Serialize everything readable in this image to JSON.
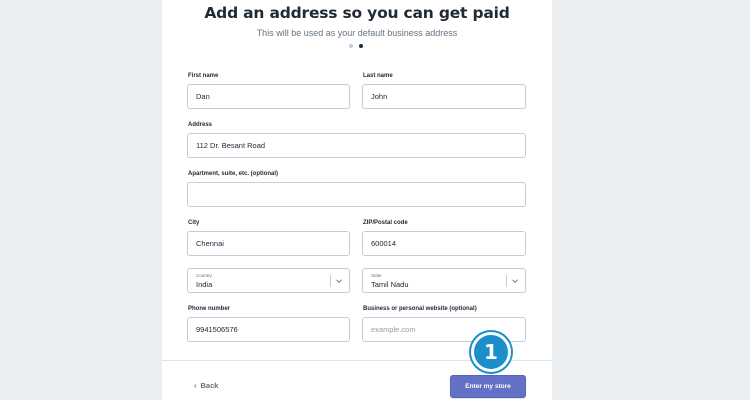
{
  "header": {
    "title": "Add an address so you can get paid",
    "subtitle": "This will be used as your default business address",
    "steps": 2,
    "current_step": 2
  },
  "form": {
    "first_name": {
      "label": "First name",
      "value": "Dan"
    },
    "last_name": {
      "label": "Last name",
      "value": "John"
    },
    "address": {
      "label": "Address",
      "value": "112 Dr. Besant Road"
    },
    "apartment": {
      "label": "Apartment, suite, etc. (optional)",
      "value": ""
    },
    "city": {
      "label": "City",
      "value": "Chennai"
    },
    "zip": {
      "label": "ZIP/Postal code",
      "value": "600014"
    },
    "country": {
      "label": "Country",
      "value": "India"
    },
    "state": {
      "label": "State",
      "value": "Tamil Nadu"
    },
    "phone": {
      "label": "Phone number",
      "value": "9941506576"
    },
    "website": {
      "label": "Business or personal website (optional)",
      "value": "",
      "placeholder": "example.com"
    }
  },
  "footer": {
    "back_label": "Back",
    "back_icon": "chevron-left-icon",
    "submit_label": "Enter my store"
  },
  "annotation": {
    "badge_number": "1"
  },
  "colors": {
    "page_bg": "#ebeef0",
    "primary": "#6371c7",
    "badge": "#1a8fc9",
    "text": "#212b36",
    "muted": "#637381"
  }
}
